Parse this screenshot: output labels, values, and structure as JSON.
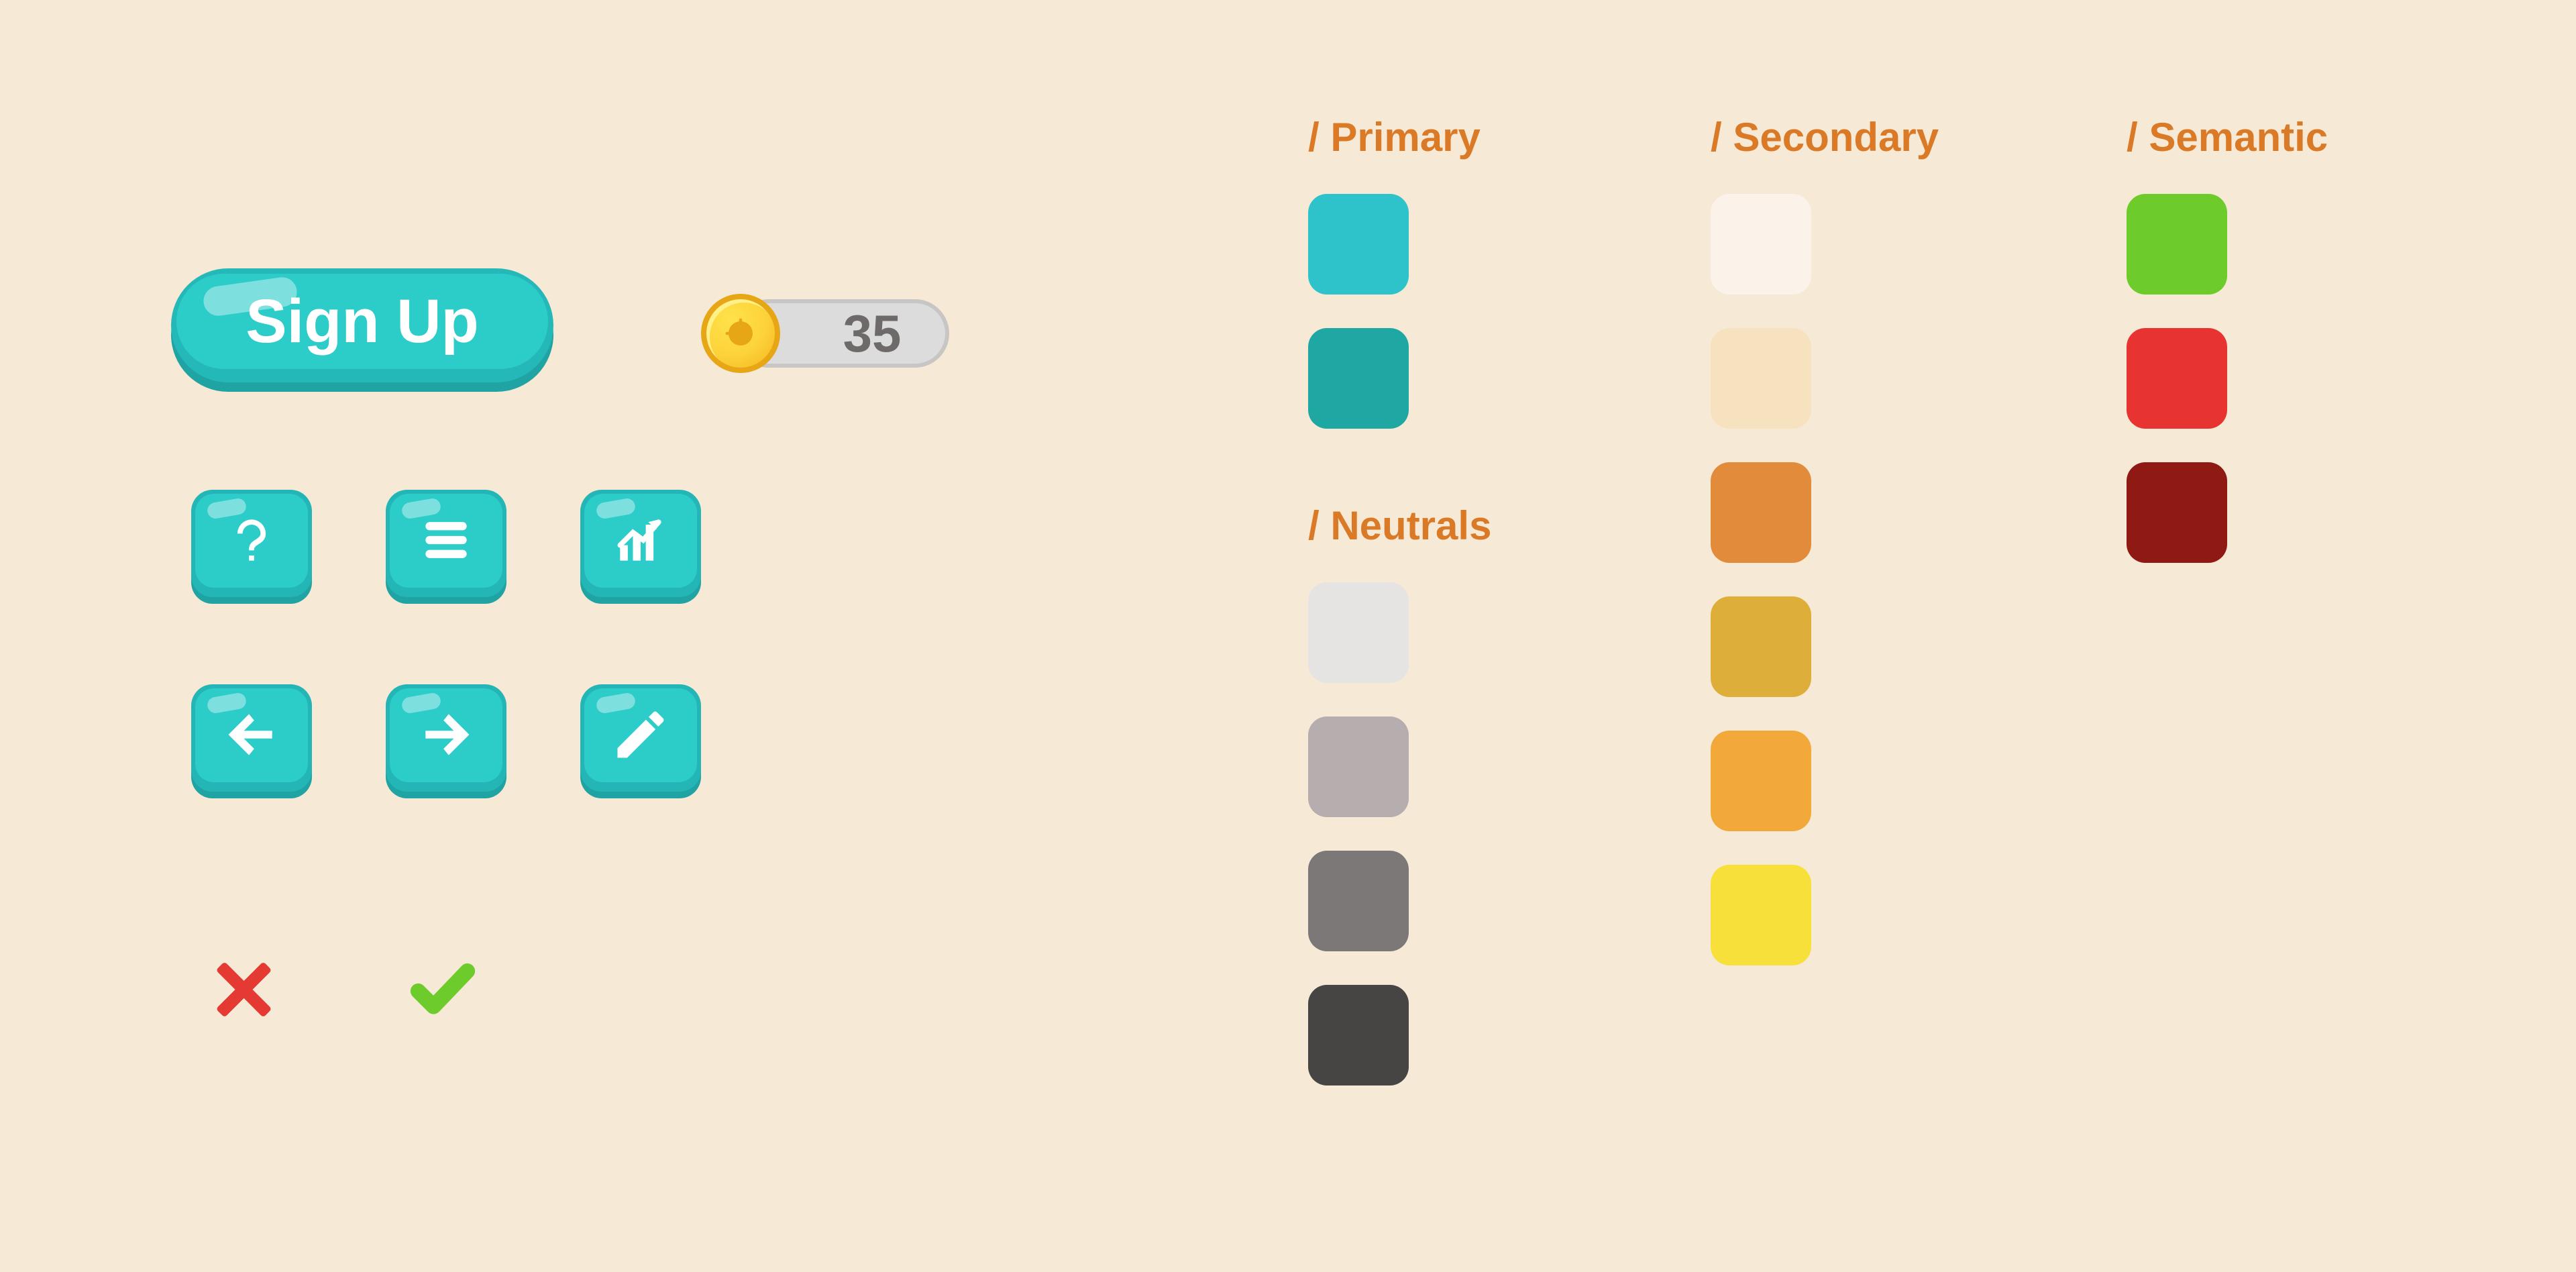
{
  "signup_label": "Sign Up",
  "coin_value": "35",
  "palette_headers": {
    "primary": "Primary",
    "neutrals": "Neutrals",
    "secondary": "Secondary",
    "semantic": "Semantic"
  },
  "slash": "/ ",
  "colors": {
    "primary": [
      "#2ec3cb",
      "#1fa8a3"
    ],
    "neutrals": [
      "#e6e3e3",
      "#b6aeae",
      "#7d7878",
      "#474444"
    ],
    "secondary": [
      "#fbf3ea",
      "#f7e2bf",
      "#e28b3b",
      "#deae3a",
      "#f3a93a",
      "#f7e03a"
    ],
    "semantic": [
      "#6dcb2c",
      "#e73431",
      "#8f1913"
    ]
  }
}
